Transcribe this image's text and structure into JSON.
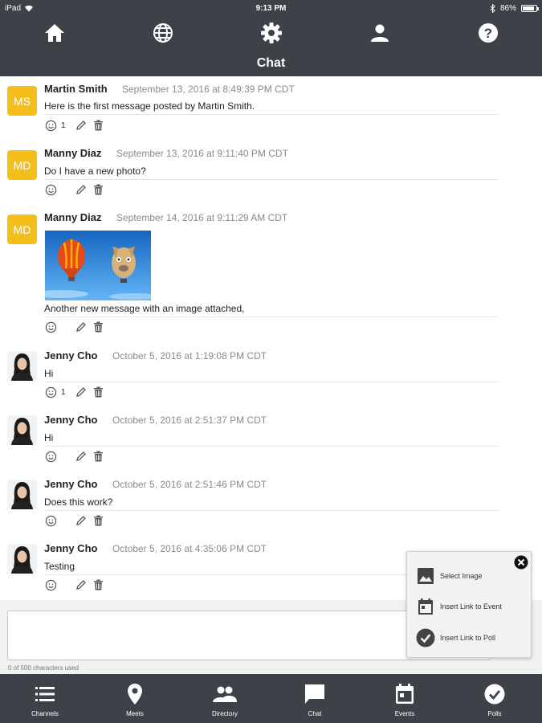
{
  "status_bar": {
    "device": "iPad",
    "time": "9:13 PM",
    "battery": "86%",
    "battery_level": 0.86
  },
  "header": {
    "title": "Chat",
    "nav_icons": [
      "home-icon",
      "globe-icon",
      "gear-icon",
      "person-icon",
      "help-icon"
    ]
  },
  "messages": [
    {
      "avatar": "MS",
      "avatar_type": "initials",
      "name": "Martin Smith",
      "time": "September 13, 2016 at 8:49:39 PM CDT",
      "text": "Here is the first message posted by Martin Smith.",
      "reaction_count": "1"
    },
    {
      "avatar": "MD",
      "avatar_type": "initials",
      "name": "Manny Diaz",
      "time": "September 13, 2016 at 9:11:40 PM CDT",
      "text": "Do I have a new photo?",
      "reaction_count": ""
    },
    {
      "avatar": "MD",
      "avatar_type": "initials",
      "name": "Manny Diaz",
      "time": "September 14, 2016 at 9:11:29 AM CDT",
      "text": "Another new message with an image attached,",
      "reaction_count": "",
      "has_image": true
    },
    {
      "avatar_type": "photo",
      "name": "Jenny Cho",
      "time": "October 5, 2016 at 1:19:08 PM CDT",
      "text": "Hi",
      "reaction_count": "1"
    },
    {
      "avatar_type": "photo",
      "name": "Jenny Cho",
      "time": "October 5, 2016 at 2:51:37 PM CDT",
      "text": "Hi",
      "reaction_count": ""
    },
    {
      "avatar_type": "photo",
      "name": "Jenny Cho",
      "time": "October 5, 2016 at 2:51:46 PM CDT",
      "text": "Does this work?",
      "reaction_count": ""
    },
    {
      "avatar_type": "photo",
      "name": "Jenny Cho",
      "time": "October 5, 2016 at 4:35:06 PM CDT",
      "text": "Testing",
      "reaction_count": ""
    }
  ],
  "compose": {
    "placeholder": "",
    "char_count": "0 of 500 characters used"
  },
  "insert_menu": {
    "items": [
      {
        "label": "Select Image",
        "icon": "image-icon"
      },
      {
        "label": "Insert Link to Event",
        "icon": "calendar-icon"
      },
      {
        "label": "Insert Link to Poll",
        "icon": "checkmark-circle-icon"
      }
    ]
  },
  "bottom_nav": {
    "tabs": [
      {
        "label": "Channels",
        "icon": "list-icon"
      },
      {
        "label": "Meets",
        "icon": "location-pin-icon"
      },
      {
        "label": "Directory",
        "icon": "people-icon"
      },
      {
        "label": "Chat",
        "icon": "chat-bubble-icon"
      },
      {
        "label": "Events",
        "icon": "calendar-icon"
      },
      {
        "label": "Polls",
        "icon": "checkmark-circle-icon"
      }
    ]
  },
  "colors": {
    "bar_bg": "#3d4249",
    "avatar_yellow": "#f5bf1b",
    "text": "#222222",
    "timestamp": "#8a8a8a"
  }
}
